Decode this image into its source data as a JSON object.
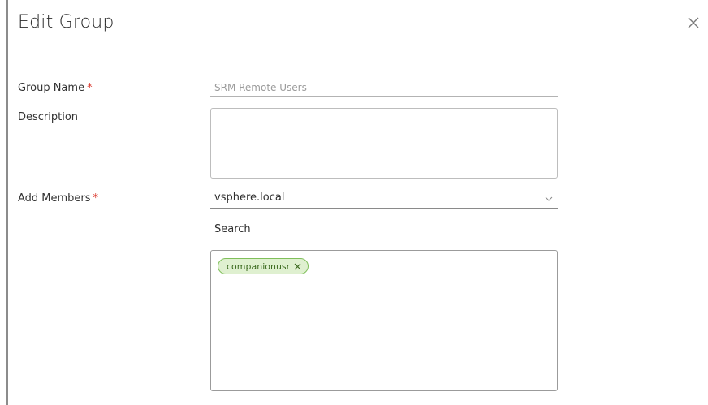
{
  "dialog": {
    "title": "Edit Group",
    "close_icon": "close-icon"
  },
  "form": {
    "group_name": {
      "label": "Group Name",
      "required_mark": "*",
      "placeholder": "SRM Remote Users",
      "value": ""
    },
    "description": {
      "label": "Description",
      "value": ""
    },
    "add_members": {
      "label": "Add Members",
      "required_mark": "*",
      "domain_selected": "vsphere.local",
      "domain_icon": "chevron-down-icon",
      "search_placeholder": "Search",
      "members": [
        {
          "name": "companionusr",
          "remove_icon": "close-icon"
        }
      ]
    }
  },
  "colors": {
    "required": "#d93025",
    "chip_bg": "#dff0d0",
    "chip_border": "#7fbf5a",
    "chip_text": "#3c6b20"
  }
}
